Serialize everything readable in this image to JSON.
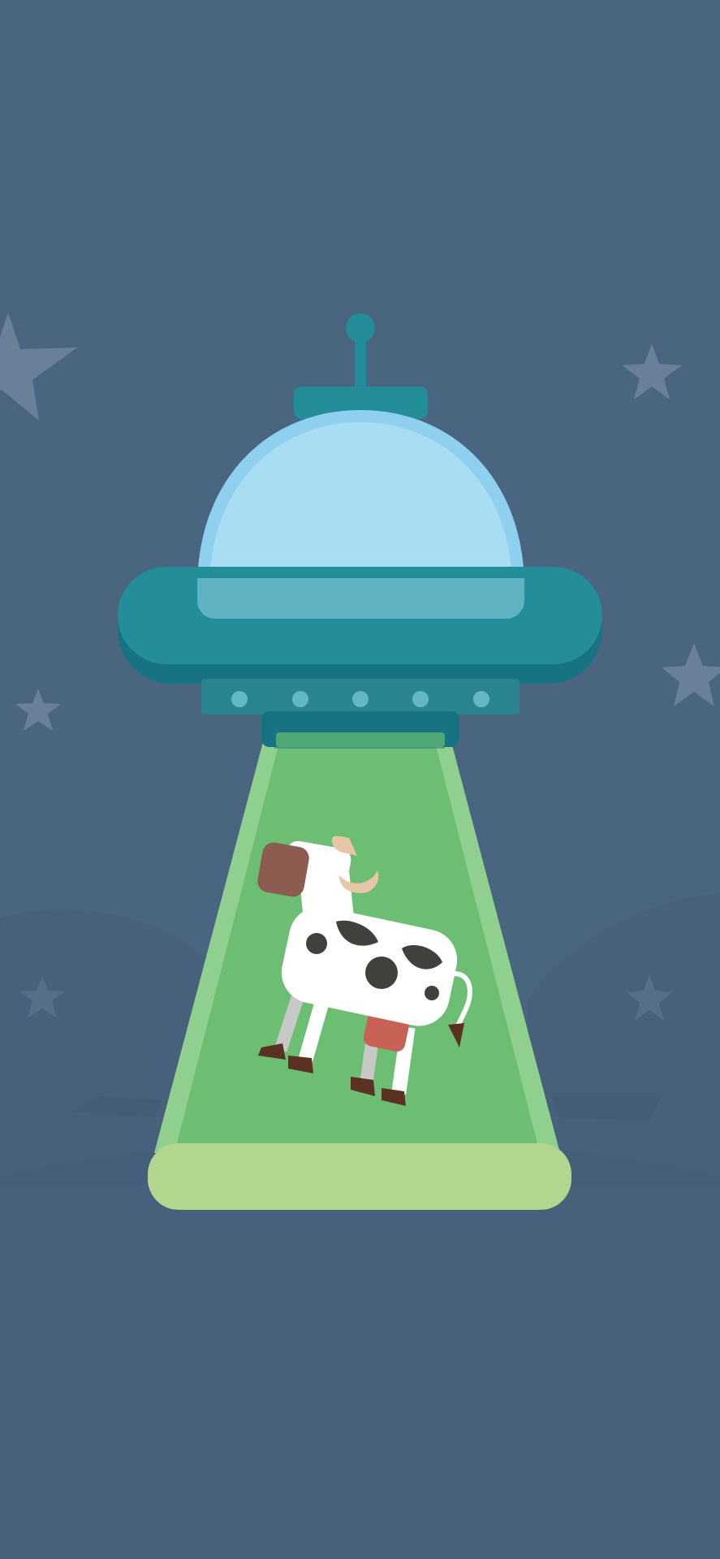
{
  "screen": {
    "kind": "illustration-wallpaper"
  },
  "colors": {
    "background": "#4a6580",
    "star": "#6a8099",
    "hill": "#435c75",
    "saucer_rim": "#238e9a",
    "saucer_rim_shadow": "#177282",
    "dome_glass": "#a9ddf3",
    "dome_outline": "#8fd0ef",
    "underside": "#2a8591",
    "light_dots": "#63b7c5",
    "beam": "#6cbe72",
    "beam_edge": "#8fd08f",
    "ground_glow": "#b2d68e",
    "cow_body": "#ffffff",
    "cow_spots": "#40403d",
    "cow_ear": "#8c5c50",
    "cow_horn": "#e6c6a6",
    "cow_udder": "#c96256",
    "cow_hoof": "#5b3221"
  },
  "icons": [
    "ufo-icon",
    "cow-icon",
    "tractor-beam-icon",
    "star-icon"
  ]
}
